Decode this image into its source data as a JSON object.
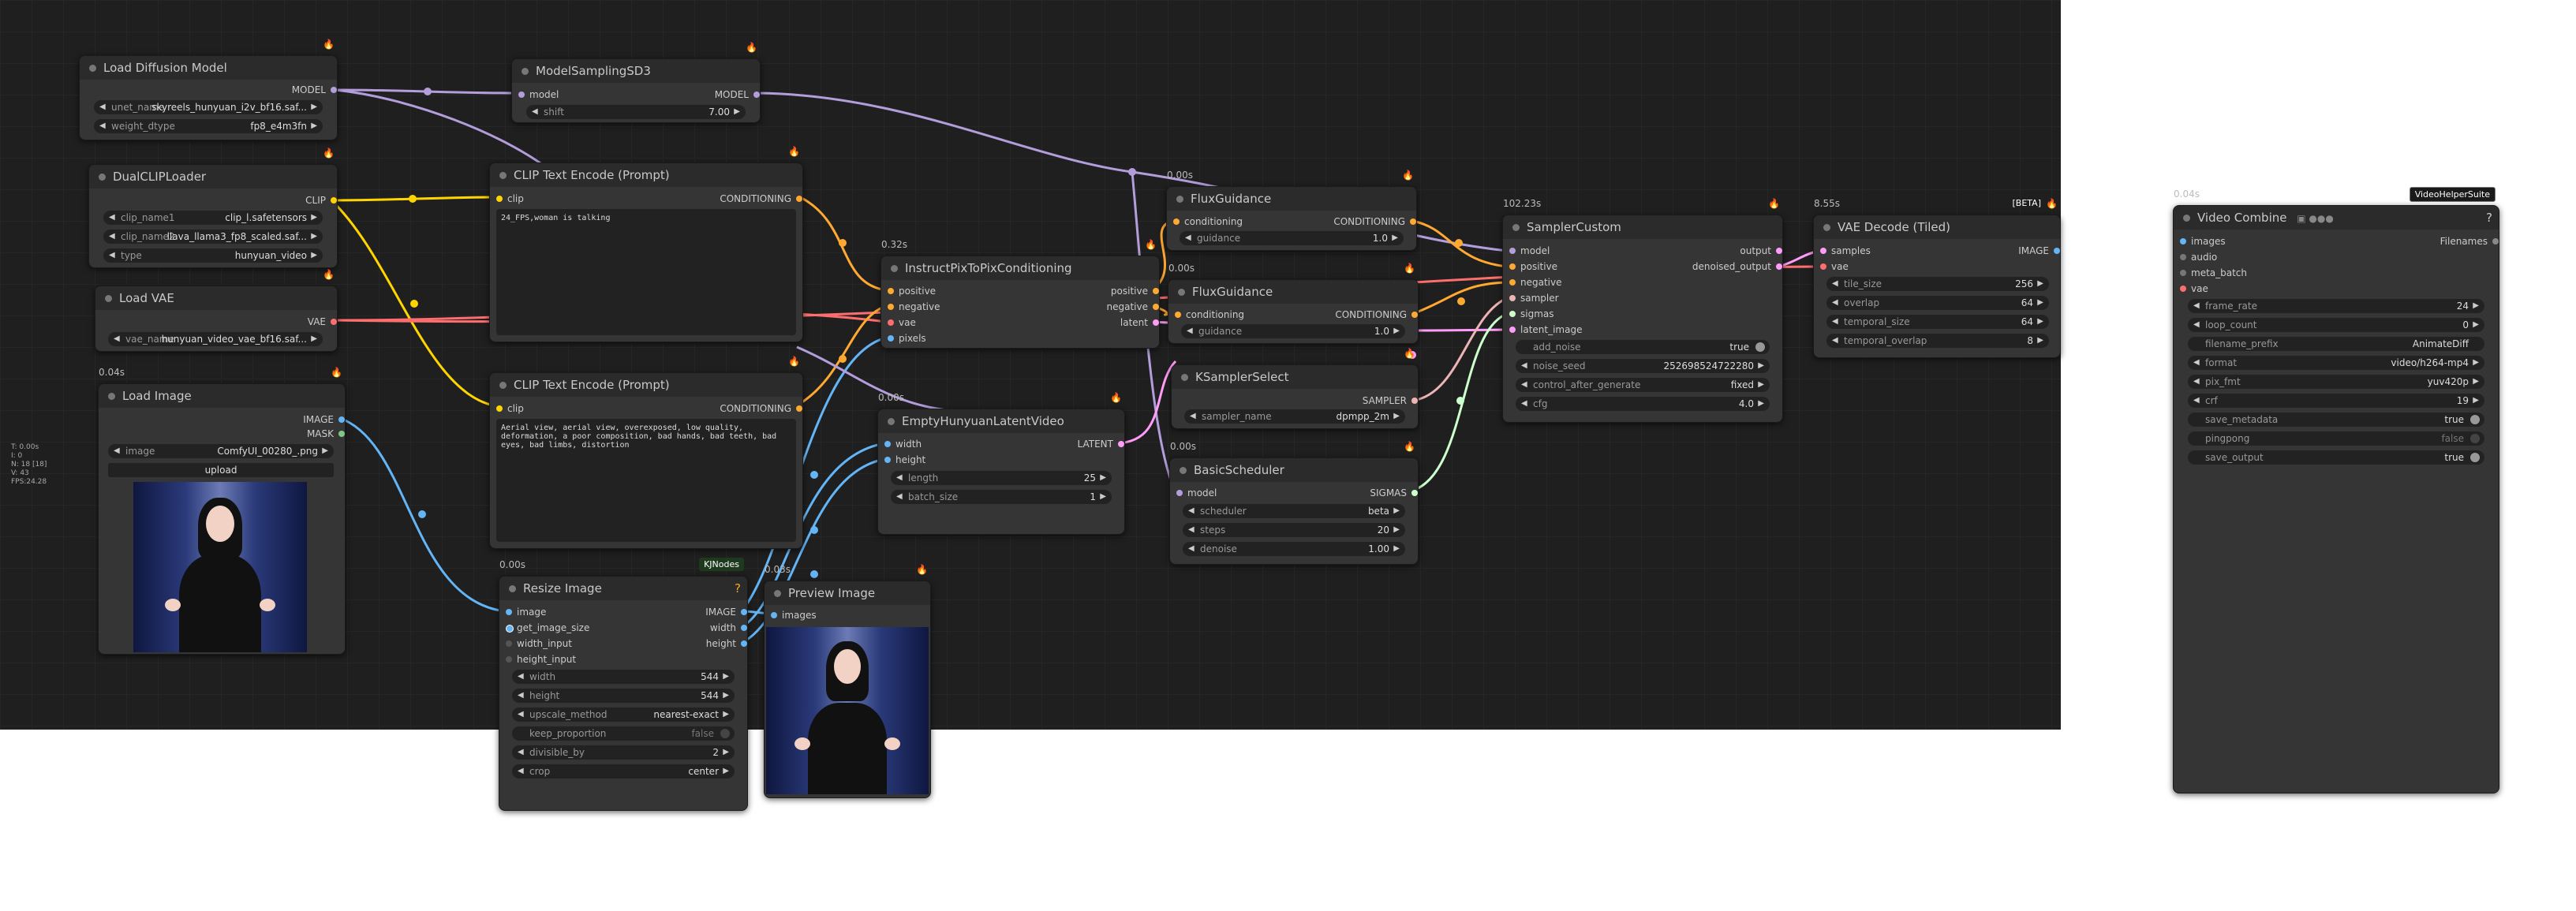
{
  "stats": [
    "T: 0.00s",
    "I: 0",
    "N: 18 [18]",
    "V: 43",
    "FPS:24.28"
  ],
  "colors": {
    "model": "#b39ddb",
    "clip": "#ffd500",
    "conditioning": "#ffa931",
    "vae": "#ff6e6e",
    "image": "#64b5f6",
    "mask": "#81c784",
    "latent": "#ff9cf9",
    "sampler": "#ecb4b4",
    "sigmas": "#cdffcd",
    "pixels": "#64b5f6"
  },
  "nodes": {
    "load_diffusion": {
      "title": "Load Diffusion Model",
      "out": "MODEL",
      "w1_label": "unet_name",
      "w1_value": "skyreels_hunyuan_i2v_bf16.saf...",
      "w2_label": "weight_dtype",
      "w2_value": "fp8_e4m3fn"
    },
    "model_sampling": {
      "title": "ModelSamplingSD3",
      "in": "model",
      "out": "MODEL",
      "w1_label": "shift",
      "w1_value": "7.00"
    },
    "dual_clip": {
      "title": "DualCLIPLoader",
      "out": "CLIP",
      "w1_label": "clip_name1",
      "w1_value": "clip_l.safetensors",
      "w2_label": "clip_name2",
      "w2_value": "llava_llama3_fp8_scaled.saf...",
      "w3_label": "type",
      "w3_value": "hunyuan_video"
    },
    "load_vae": {
      "title": "Load VAE",
      "out": "VAE",
      "w1_label": "vae_name",
      "w1_value": "hunyuan_video_vae_bf16.saf..."
    },
    "load_image": {
      "badge": "0.04s",
      "title": "Load Image",
      "out1": "IMAGE",
      "out2": "MASK",
      "w1_label": "image",
      "w1_value": "ComfyUI_00280_.png",
      "button": "upload"
    },
    "clip_pos": {
      "title": "CLIP Text Encode (Prompt)",
      "in": "clip",
      "out": "CONDITIONING",
      "text": "24_FPS,woman is talking"
    },
    "clip_neg": {
      "title": "CLIP Text Encode (Prompt)",
      "in": "clip",
      "out": "CONDITIONING",
      "text": "Aerial view, aerial view, overexposed, low quality, deformation, a poor composition, bad hands, bad teeth, bad eyes, bad limbs, distortion"
    },
    "instruct": {
      "badge": "0.32s",
      "title": "InstructPixToPixConditioning",
      "in1": "positive",
      "in2": "negative",
      "in3": "vae",
      "in4": "pixels",
      "out1": "positive",
      "out2": "negative",
      "out3": "latent"
    },
    "empty_latent": {
      "badge": "0.00s",
      "title": "EmptyHunyuanLatentVideo",
      "in1": "width",
      "in2": "height",
      "out": "LATENT",
      "w1_label": "length",
      "w1_value": "25",
      "w2_label": "batch_size",
      "w2_value": "1"
    },
    "resize": {
      "badge": "0.00s",
      "tag": "KJNodes",
      "title": "Resize Image",
      "in1": "image",
      "in2": "get_image_size",
      "in3": "width_input",
      "in4": "height_input",
      "out1": "IMAGE",
      "out2": "width",
      "out3": "height",
      "w1_label": "width",
      "w1_value": "544",
      "w2_label": "height",
      "w2_value": "544",
      "w3_label": "upscale_method",
      "w3_value": "nearest-exact",
      "w4_label": "keep_proportion",
      "w4_value": "false",
      "w5_label": "divisible_by",
      "w5_value": "2",
      "w6_label": "crop",
      "w6_value": "center"
    },
    "preview": {
      "badge": "0.03s",
      "title": "Preview Image",
      "in": "images"
    },
    "flux1": {
      "badge": "0.00s",
      "title": "FluxGuidance",
      "in": "conditioning",
      "out": "CONDITIONING",
      "w1_label": "guidance",
      "w1_value": "1.0"
    },
    "flux2": {
      "badge": "0.00s",
      "title": "FluxGuidance",
      "in": "conditioning",
      "out": "CONDITIONING",
      "w1_label": "guidance",
      "w1_value": "1.0"
    },
    "ksampler_select": {
      "title": "KSamplerSelect",
      "out": "SAMPLER",
      "w1_label": "sampler_name",
      "w1_value": "dpmpp_2m"
    },
    "basic_sched": {
      "badge": "0.00s",
      "title": "BasicScheduler",
      "in": "model",
      "out": "SIGMAS",
      "w1_label": "scheduler",
      "w1_value": "beta",
      "w2_label": "steps",
      "w2_value": "20",
      "w3_label": "denoise",
      "w3_value": "1.00"
    },
    "sampler_custom": {
      "badge": "102.23s",
      "title": "SamplerCustom",
      "in1": "model",
      "in2": "positive",
      "in3": "negative",
      "in4": "sampler",
      "in5": "sigmas",
      "in6": "latent_image",
      "out1": "output",
      "out2": "denoised_output",
      "w1_label": "add_noise",
      "w1_value": "true",
      "w2_label": "noise_seed",
      "w2_value": "252698524722280",
      "w3_label": "control_after_generate",
      "w3_value": "fixed",
      "w4_label": "cfg",
      "w4_value": "4.0"
    },
    "vae_decode": {
      "badge": "8.55s",
      "tag": "[BETA]",
      "title": "VAE Decode (Tiled)",
      "in1": "samples",
      "in2": "vae",
      "out": "IMAGE",
      "w1_label": "tile_size",
      "w1_value": "256",
      "w2_label": "overlap",
      "w2_value": "64",
      "w3_label": "temporal_size",
      "w3_value": "64",
      "w4_label": "temporal_overlap",
      "w4_value": "8"
    },
    "video_combine": {
      "badge": "0.04s",
      "tag": "VideoHelperSuite",
      "title": "Video Combine",
      "help": "?",
      "in1": "images",
      "in2": "audio",
      "in3": "meta_batch",
      "in4": "vae",
      "out": "Filenames",
      "w1_label": "frame_rate",
      "w1_value": "24",
      "w2_label": "loop_count",
      "w2_value": "0",
      "w3_label": "filename_prefix",
      "w3_value": "AnimateDiff",
      "w4_label": "format",
      "w4_value": "video/h264-mp4",
      "w5_label": "pix_fmt",
      "w5_value": "yuv420p",
      "w6_label": "crf",
      "w6_value": "19",
      "w7_label": "save_metadata",
      "w7_value": "true",
      "w8_label": "pingpong",
      "w8_value": "false",
      "w9_label": "save_output",
      "w9_value": "true"
    }
  }
}
